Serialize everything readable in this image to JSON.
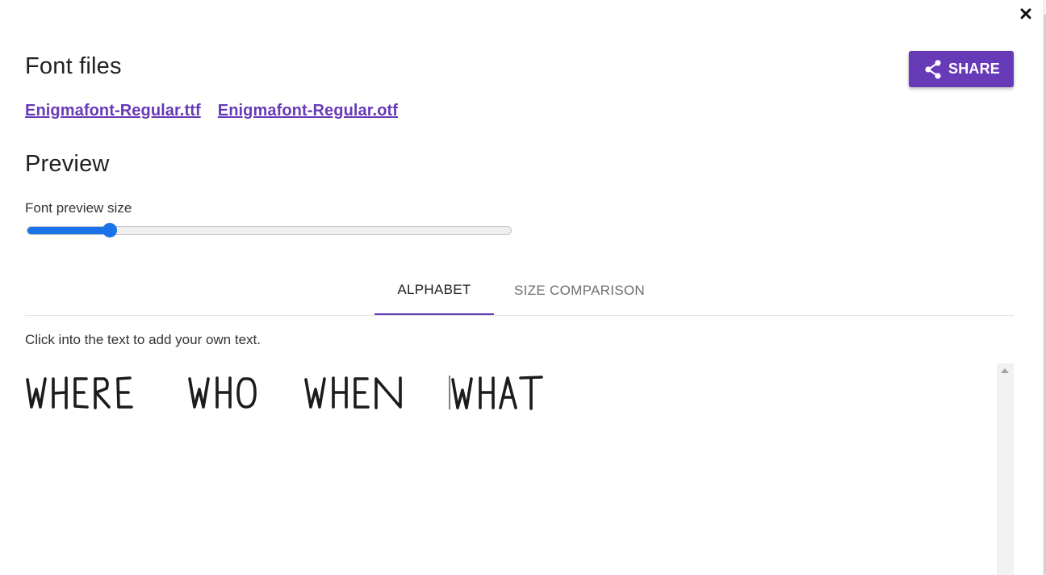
{
  "dialog": {
    "close_icon": "close-icon",
    "share": {
      "label": "SHARE",
      "icon": "share-icon",
      "background": "#673ab7"
    }
  },
  "font_files": {
    "heading": "Font files",
    "files": [
      {
        "name": "Enigmafont-Regular.ttf"
      },
      {
        "name": "Enigmafont-Regular.otf"
      }
    ],
    "link_color": "#673ab7"
  },
  "preview": {
    "heading": "Preview",
    "size_label": "Font preview size",
    "size_slider": {
      "fraction": 0.16,
      "accent": "#1a73e8"
    }
  },
  "tabs": [
    {
      "label": "ALPHABET",
      "active": true
    },
    {
      "label": "SIZE COMPARISON",
      "active": false
    }
  ],
  "hint": "Click into the text to add your own text.",
  "sample_words": [
    "WHERE",
    "WHO",
    "WHEN",
    "WHAT"
  ]
}
